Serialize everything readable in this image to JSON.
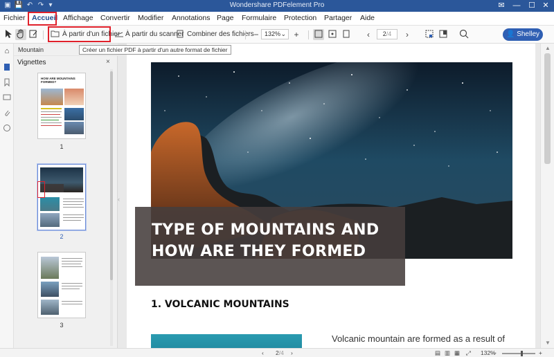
{
  "window": {
    "title": "Wondershare PDFelement Pro",
    "controls": {
      "mail": "✉",
      "minimize": "—",
      "maximize": "☐",
      "close": "✕"
    }
  },
  "quick_access": {
    "app": "▣",
    "save": "💾",
    "undo": "↶",
    "redo": "↷",
    "dropdown": "▾"
  },
  "menu": {
    "items": [
      "Fichier",
      "Accueil",
      "Affichage",
      "Convertir",
      "Modifier",
      "Annotations",
      "Page",
      "Formulaire",
      "Protection",
      "Partager",
      "Aide"
    ],
    "active": "Accueil"
  },
  "toolbar": {
    "from_file": "À partir d'un fichier",
    "from_scanner": "À partir du scanner",
    "combine": "Combiner des fichiers",
    "zoom_value": "132%",
    "zoom_out": "−",
    "zoom_in": "+",
    "page_current": "2",
    "page_total": "/4",
    "user_name": "Shelley"
  },
  "tooltip": "Créer un fichier PDF à partir d'un autre format de fichier",
  "breadcrumb": "Mountain",
  "thumbnails": {
    "heading": "Vignettes",
    "close": "×",
    "pages": [
      "1",
      "2",
      "3"
    ],
    "selected": "2",
    "thumb1_title": "HOW ARE MOUNTAINS FORMED?"
  },
  "document": {
    "title": "TYPE OF MOUNTAINS AND HOW ARE THEY FORMED",
    "section_heading": "1. VOLCANIC MOUNTAINS",
    "body_start": "Volcanic mountain are formed as a result of"
  },
  "statusbar": {
    "page_current": "2",
    "page_total": "/4",
    "zoom": "132%"
  },
  "colors": {
    "accent": "#2b579a",
    "highlight": "#e0202a",
    "user_button": "#2f5fb3"
  }
}
